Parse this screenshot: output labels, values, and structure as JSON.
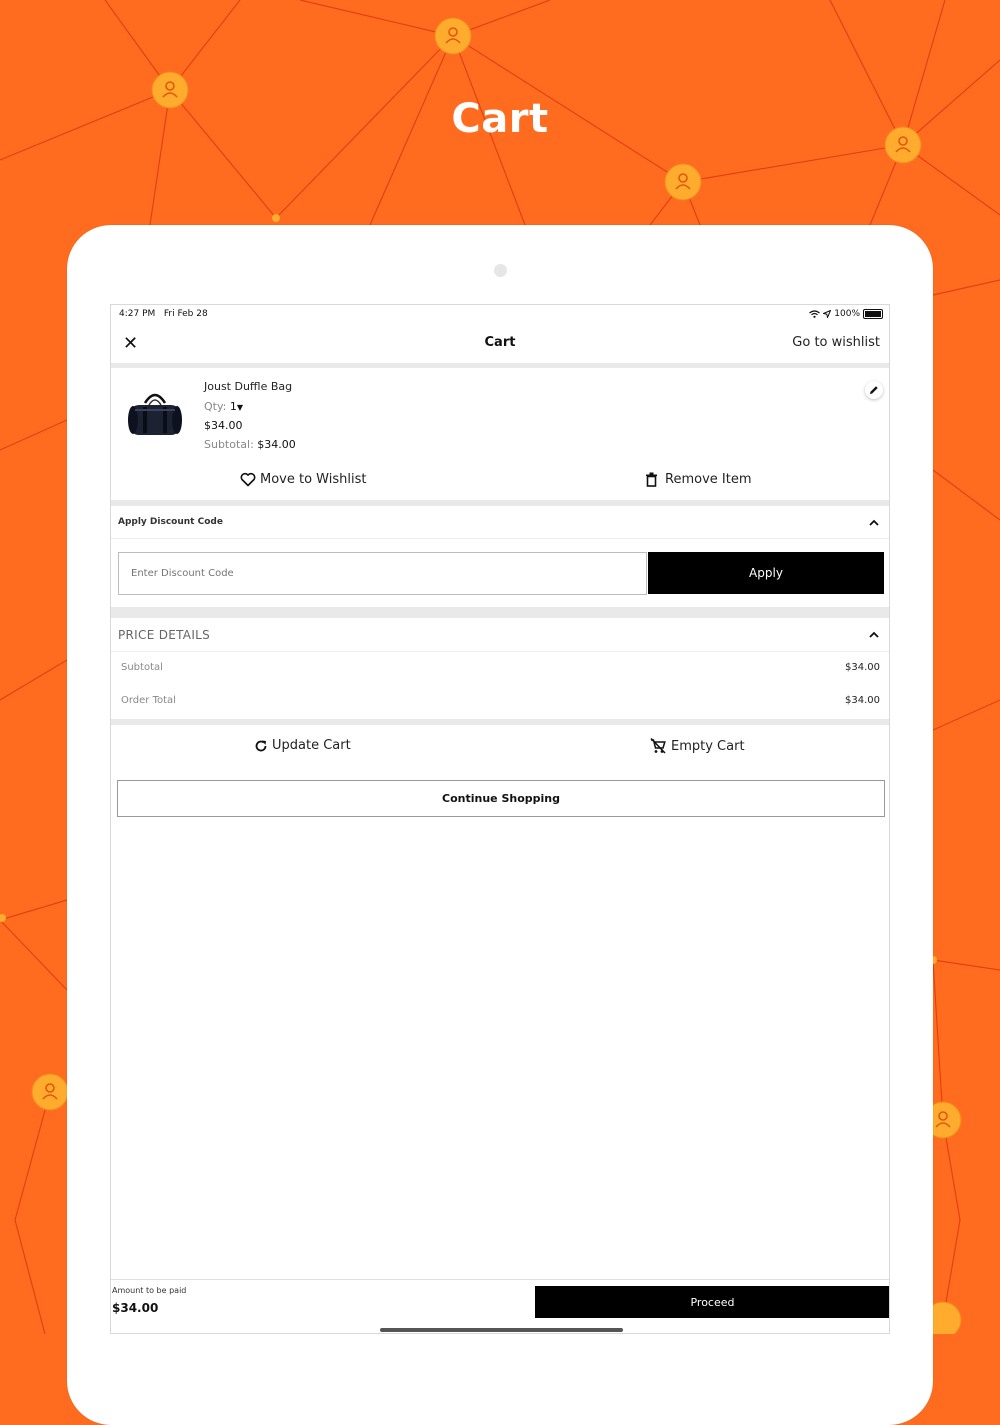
{
  "page": {
    "title": "Cart"
  },
  "status_bar": {
    "time": "4:27 PM",
    "date": "Fri Feb 28",
    "battery": "100%"
  },
  "nav": {
    "title": "Cart",
    "wishlist_link": "Go to wishlist",
    "close_icon": "close-icon"
  },
  "item": {
    "name": "Joust Duffle Bag",
    "qty_label": "Qty:",
    "qty_value": "1",
    "price": "$34.00",
    "subtotal_label": "Subtotal:",
    "subtotal_value": "$34.00",
    "move_to_wishlist": "Move to Wishlist",
    "remove_item": "Remove Item"
  },
  "discount": {
    "label": "Apply Discount Code",
    "placeholder": "Enter Discount Code",
    "apply_label": "Apply"
  },
  "price_details": {
    "heading": "PRICE DETAILS",
    "rows": [
      {
        "label": "Subtotal",
        "value": "$34.00"
      },
      {
        "label": "Order Total",
        "value": "$34.00"
      }
    ]
  },
  "cart_actions": {
    "update": "Update Cart",
    "empty": "Empty Cart",
    "continue": "Continue Shopping"
  },
  "footer": {
    "amount_label": "Amount to be paid",
    "amount_value": "$34.00",
    "proceed": "Proceed"
  },
  "colors": {
    "background": "#ff6c1f",
    "node": "#ffab2e",
    "line": "#e23b12",
    "button": "#000000"
  }
}
